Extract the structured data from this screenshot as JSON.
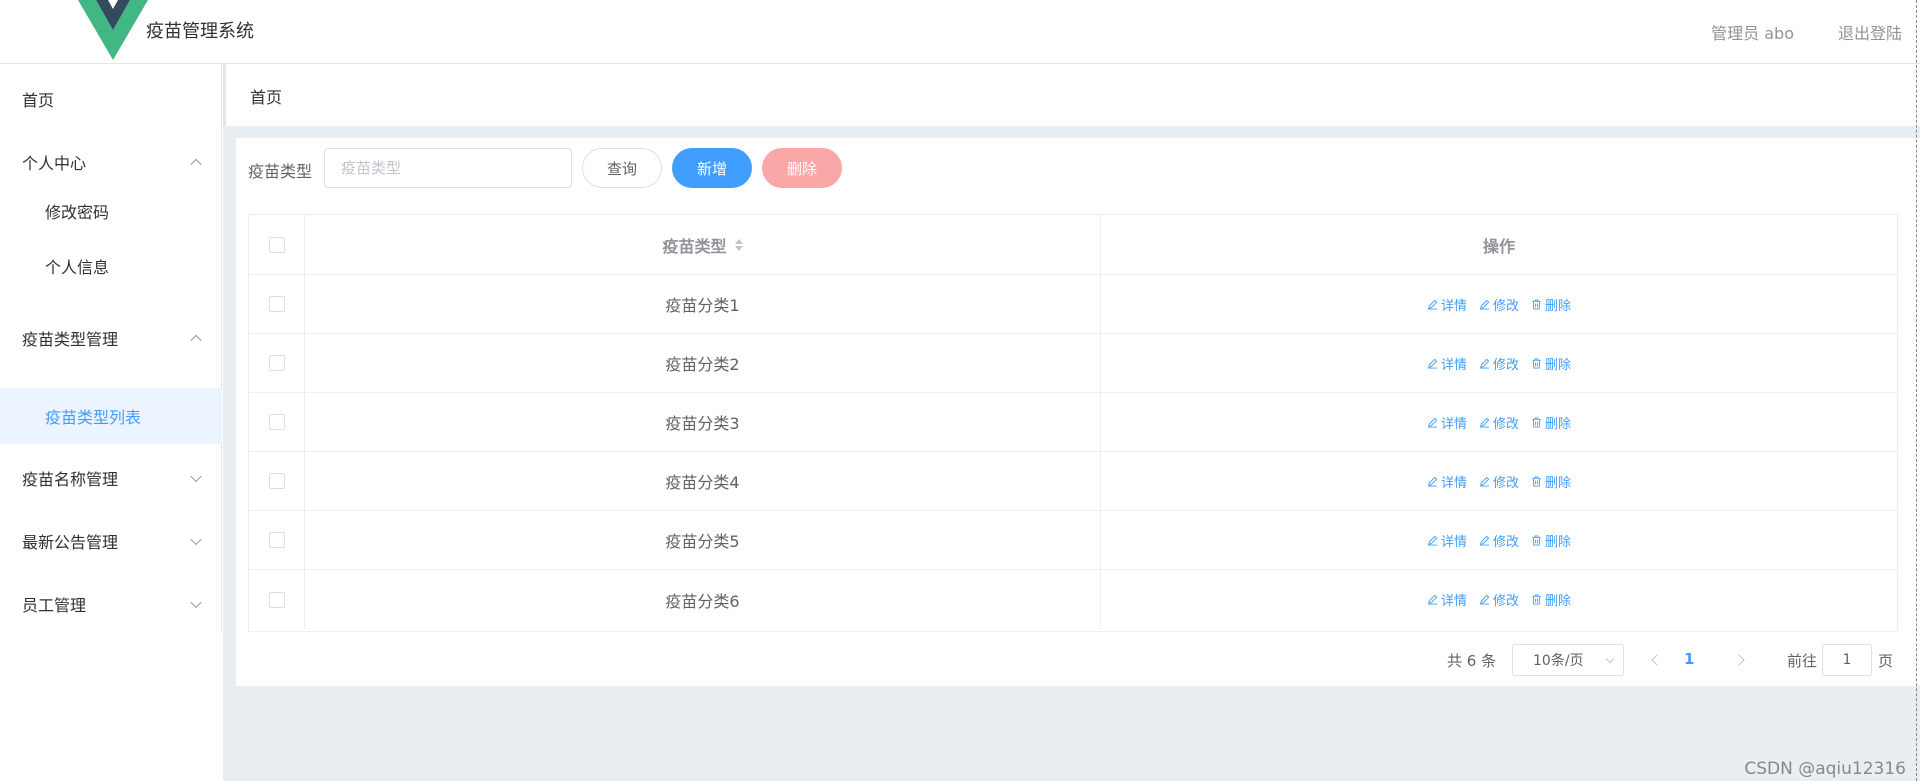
{
  "header": {
    "app_title": "疫苗管理系统",
    "user_label": "管理员 abo",
    "logout_label": "退出登陆",
    "logo_colors": {
      "outer": "#41b883",
      "inner": "#35495e"
    }
  },
  "sidebar": {
    "items": [
      {
        "label": "首页"
      },
      {
        "label": "个人中心"
      },
      {
        "label": "修改密码"
      },
      {
        "label": "个人信息"
      },
      {
        "label": "疫苗类型管理"
      },
      {
        "label": "疫苗类型列表"
      },
      {
        "label": "疫苗名称管理"
      },
      {
        "label": "最新公告管理"
      },
      {
        "label": "员工管理"
      }
    ]
  },
  "breadcrumb": "首页",
  "search": {
    "label": "疫苗类型",
    "placeholder": "疫苗类型",
    "value": ""
  },
  "buttons": {
    "query": "查询",
    "add": "新增",
    "delete": "删除"
  },
  "table": {
    "columns": {
      "type": "疫苗类型",
      "actions": "操作"
    },
    "rows": [
      {
        "type": "疫苗分类1"
      },
      {
        "type": "疫苗分类2"
      },
      {
        "type": "疫苗分类3"
      },
      {
        "type": "疫苗分类4"
      },
      {
        "type": "疫苗分类5"
      },
      {
        "type": "疫苗分类6"
      }
    ],
    "row_actions": {
      "detail": "详情",
      "edit": "修改",
      "delete": "删除"
    }
  },
  "pagination": {
    "total": "共 6 条",
    "page_size": "10条/页",
    "current_page": "1",
    "goto_label": "前往",
    "goto_value": "1",
    "page_suffix": "页"
  },
  "watermark": "CSDN @aqiu12316",
  "colors": {
    "primary": "#409eff",
    "danger_disabled": "#f9a7a7",
    "active_menu_bg": "#ecf5ff",
    "main_bg": "#e9eef3"
  }
}
